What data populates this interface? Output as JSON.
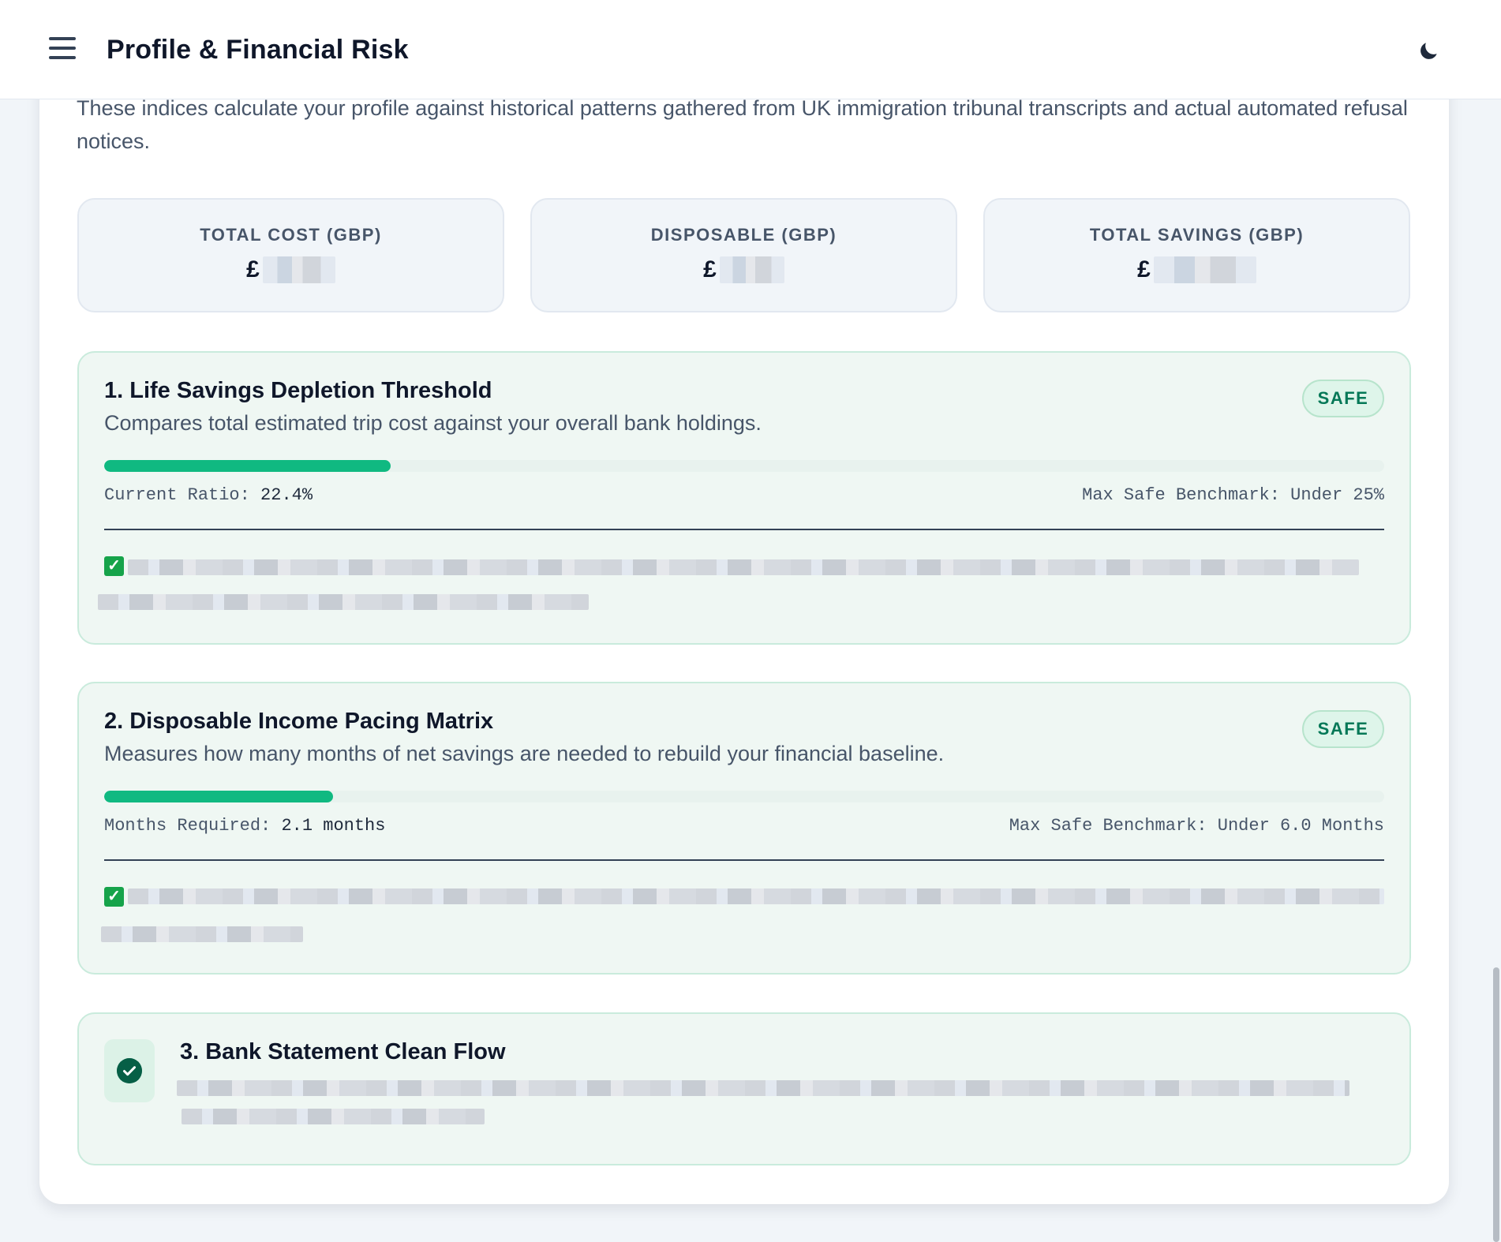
{
  "header": {
    "title": "Profile & Financial Risk",
    "menu_icon": "hamburger-menu-icon",
    "theme_icon": "moon-icon"
  },
  "intro": "These indices calculate your profile against historical patterns gathered from UK immigration tribunal transcripts and actual automated refusal notices.",
  "stats": [
    {
      "label": "TOTAL COST (GBP)",
      "currency": "£"
    },
    {
      "label": "DISPOSABLE (GBP)",
      "currency": "£"
    },
    {
      "label": "TOTAL SAVINGS (GBP)",
      "currency": "£"
    }
  ],
  "metrics": [
    {
      "title": "1. Life Savings Depletion Threshold",
      "description": "Compares total estimated trip cost against your overall bank holdings.",
      "badge": "SAFE",
      "progress_fraction": 0.224,
      "left_label": "Current Ratio:",
      "left_value": "22.4%",
      "right_label": "Max Safe Benchmark: Under 25%",
      "check_icon": "check-box-icon"
    },
    {
      "title": "2. Disposable Income Pacing Matrix",
      "description": "Measures how many months of net savings are needed to rebuild your financial baseline.",
      "badge": "SAFE",
      "progress_fraction": 0.179,
      "left_label": "Months Required:",
      "left_value": "2.1 months",
      "right_label": "Max Safe Benchmark: Under 6.0 Months",
      "check_icon": "check-box-icon"
    },
    {
      "title": "3. Bank Statement Clean Flow",
      "status_icon": "check-circle-icon"
    }
  ],
  "colors": {
    "accent": "#10b981",
    "safe_text": "#047857",
    "card_bg": "#eff7f3"
  }
}
